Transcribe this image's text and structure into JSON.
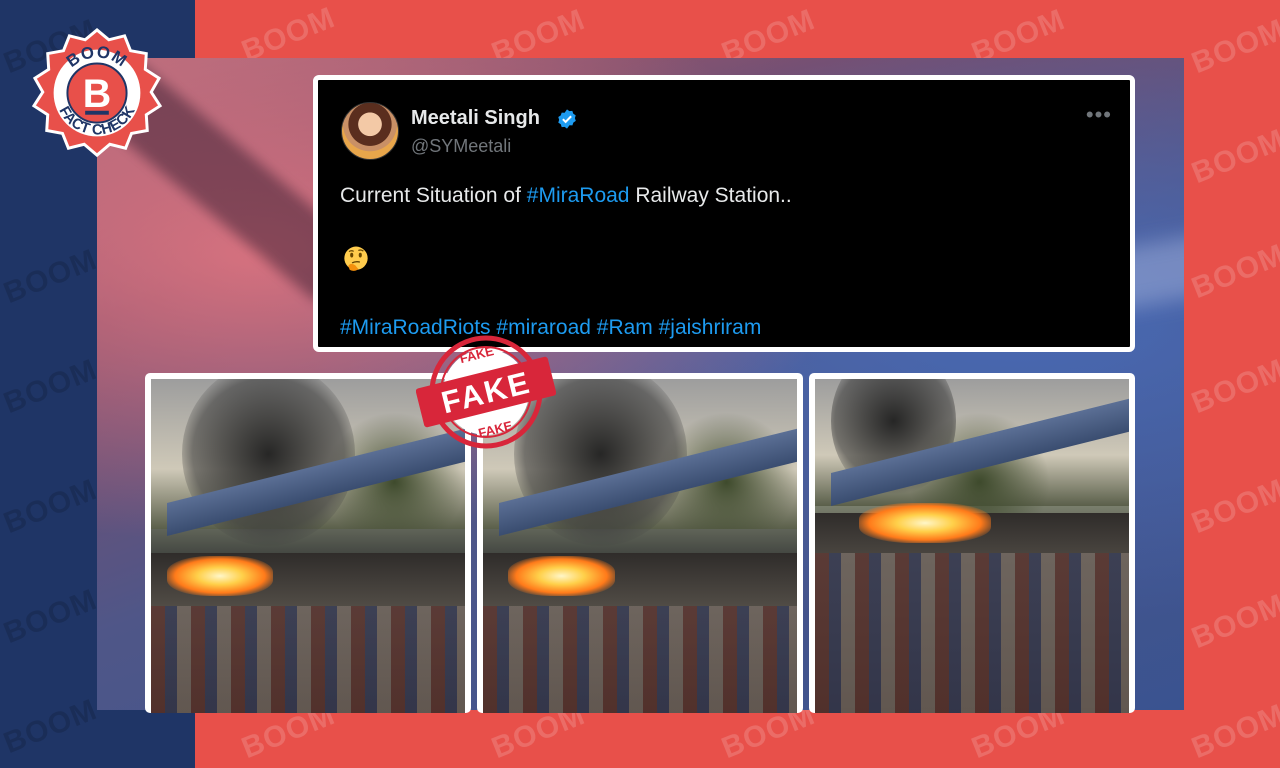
{
  "watermark": {
    "text": "BOOM"
  },
  "logo": {
    "top": "BOOM",
    "letter": "B",
    "bottom": "FACT CHECK"
  },
  "tweet": {
    "name": "Meetali Singh",
    "handle": "@SYMeetali",
    "more_label": "•••",
    "text_prefix": "Current Situation of ",
    "text_link": "#MiraRoad",
    "text_suffix": " Railway Station..",
    "emoji": "thinking-face-emoji",
    "hashtags": "#MiraRoadRiots #miraroad #Ram #jaishriram"
  },
  "stamp": {
    "label": "FAKE",
    "ring_text": "FAKE"
  },
  "colors": {
    "left_band": "#1f3566",
    "right_band": "#e8504a",
    "tweet_bg": "#000000",
    "link": "#1d9bf0",
    "stamp_red": "#d8263a"
  }
}
